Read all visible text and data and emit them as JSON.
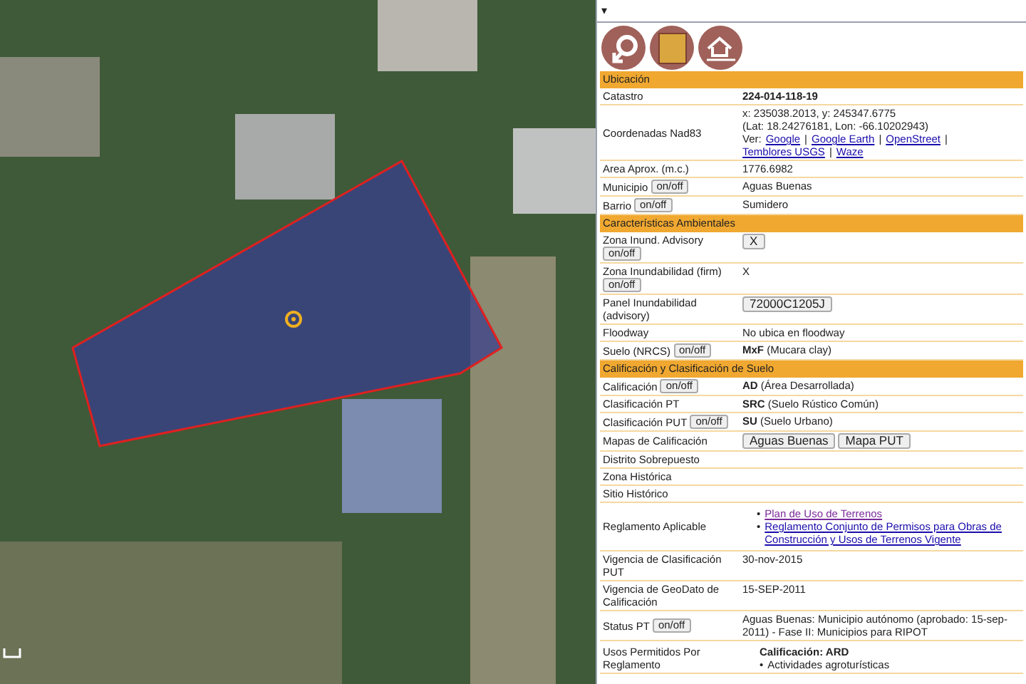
{
  "panel": {
    "caret": "▾",
    "sections": [
      {
        "title": "Ubicación",
        "rows": [
          {
            "kind": "bold_text",
            "label": "Catastro",
            "value": "224-014-118-19"
          },
          {
            "kind": "coords",
            "label": "Coordenadas Nad83",
            "lines": [
              "x: 235038.2013, y: 245347.6775",
              "(Lat: 18.24276181, Lon: -66.10202943)"
            ],
            "links_prefix": "Ver:",
            "separator": "|",
            "links": [
              "Google",
              "Google Earth",
              "OpenStreet",
              "Temblores USGS",
              "Waze"
            ]
          },
          {
            "kind": "text",
            "label": "Area Aprox. (m.c.)",
            "value": "1776.6982"
          },
          {
            "kind": "text",
            "label": "Municipio",
            "toggle": "on/off",
            "value": "Aguas Buenas"
          },
          {
            "kind": "text",
            "label": "Barrio",
            "toggle": "on/off",
            "value": "Sumidero"
          }
        ]
      },
      {
        "title": "Características Ambientales",
        "rows": [
          {
            "kind": "buttons",
            "label": "Zona Inund. Advisory",
            "toggle": "on/off",
            "buttons": [
              "X"
            ]
          },
          {
            "kind": "text",
            "label": "Zona Inundabilidad (firm)",
            "toggle": "on/off",
            "value": "X"
          },
          {
            "kind": "buttons",
            "label": "Panel Inundabilidad (advisory)",
            "buttons": [
              "72000C1205J"
            ]
          },
          {
            "kind": "text",
            "label": "Floodway",
            "value": "No ubica en floodway"
          },
          {
            "kind": "text",
            "label": "Suelo (NRCS)",
            "toggle": "on/off",
            "value": "**MxF** (Mucara clay)"
          }
        ]
      },
      {
        "title": "Calificación y Clasificación de Suelo",
        "rows": [
          {
            "kind": "text",
            "label": "Calificación",
            "toggle": "on/off",
            "value": "**AD** (Área Desarrollada)"
          },
          {
            "kind": "text",
            "label": "Clasificación PT",
            "value": "**SRC** (Suelo Rústico Común)"
          },
          {
            "kind": "text",
            "label": "Clasificación PUT",
            "toggle": "on/off",
            "value": "**SU** (Suelo Urbano)"
          },
          {
            "kind": "buttons",
            "label": "Mapas de Calificación",
            "buttons": [
              "Aguas Buenas",
              "Mapa PUT"
            ]
          },
          {
            "kind": "text",
            "label": "Distrito Sobrepuesto"
          },
          {
            "kind": "text",
            "label": "Zona Histórica"
          },
          {
            "kind": "text",
            "label": "Sitio Histórico"
          },
          {
            "kind": "links",
            "label": "Reglamento Aplicable",
            "bullet": "•",
            "links": [
              {
                "text": "Plan de Uso de Terrenos",
                "visited": true
              },
              {
                "text": "Reglamento Conjunto de Permisos para Obras de Construcción y Usos de Terrenos Vigente",
                "visited": false
              }
            ]
          },
          {
            "kind": "text",
            "label": "Vigencia de Clasificación PUT",
            "value": "30-nov-2015"
          },
          {
            "kind": "text",
            "label": "Vigencia de GeoDato de Calificación",
            "value": "15-SEP-2011"
          },
          {
            "kind": "text",
            "label": "Status PT",
            "toggle": "on/off",
            "value": "Aguas Buenas: Municipio autónomo (aprobado: 15-sep-2011) - Fase II: Municipios para RIPOT"
          },
          {
            "kind": "uses",
            "label": "Usos Permitidos Por Reglamento",
            "heading": "Calificación: ARD",
            "bullet": "•",
            "items": [
              "Actividades agroturísticas"
            ]
          }
        ]
      }
    ]
  }
}
